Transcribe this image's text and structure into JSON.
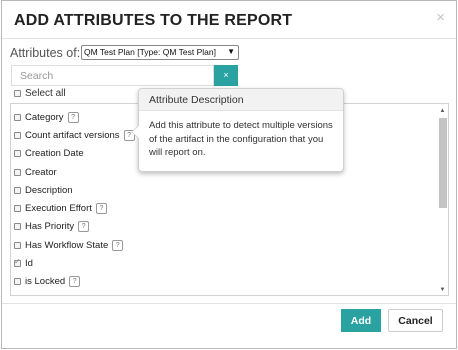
{
  "dialog": {
    "title": "ADD ATTRIBUTES TO THE REPORT",
    "close_icon": "×"
  },
  "attributes_of": {
    "label": "Attributes of:",
    "selected": "QM Test Plan [Type: QM Test Plan]",
    "arrow": "▼"
  },
  "search": {
    "placeholder": "Search",
    "clear_icon": "×"
  },
  "select_all": "Select all",
  "items": [
    {
      "label": "Category",
      "checked": false,
      "help": true
    },
    {
      "label": "Count artifact versions",
      "checked": false,
      "help": true
    },
    {
      "label": "Creation Date",
      "checked": false,
      "help": false
    },
    {
      "label": "Creator",
      "checked": false,
      "help": false
    },
    {
      "label": "Description",
      "checked": false,
      "help": false
    },
    {
      "label": "Execution Effort",
      "checked": false,
      "help": true
    },
    {
      "label": "Has Priority",
      "checked": false,
      "help": true
    },
    {
      "label": "Has Workflow State",
      "checked": false,
      "help": true
    },
    {
      "label": "Id",
      "checked": true,
      "help": false
    },
    {
      "label": "is Locked",
      "checked": false,
      "help": true
    }
  ],
  "help_glyph": "?",
  "tooltip": {
    "header": "Attribute Description",
    "body": "Add this attribute to detect multiple versions of the artifact in the configuration that you will report on."
  },
  "scroll": {
    "up": "▲",
    "down": "▼"
  },
  "buttons": {
    "add": "Add",
    "cancel": "Cancel"
  },
  "colors": {
    "accent": "#2aa2a2"
  }
}
